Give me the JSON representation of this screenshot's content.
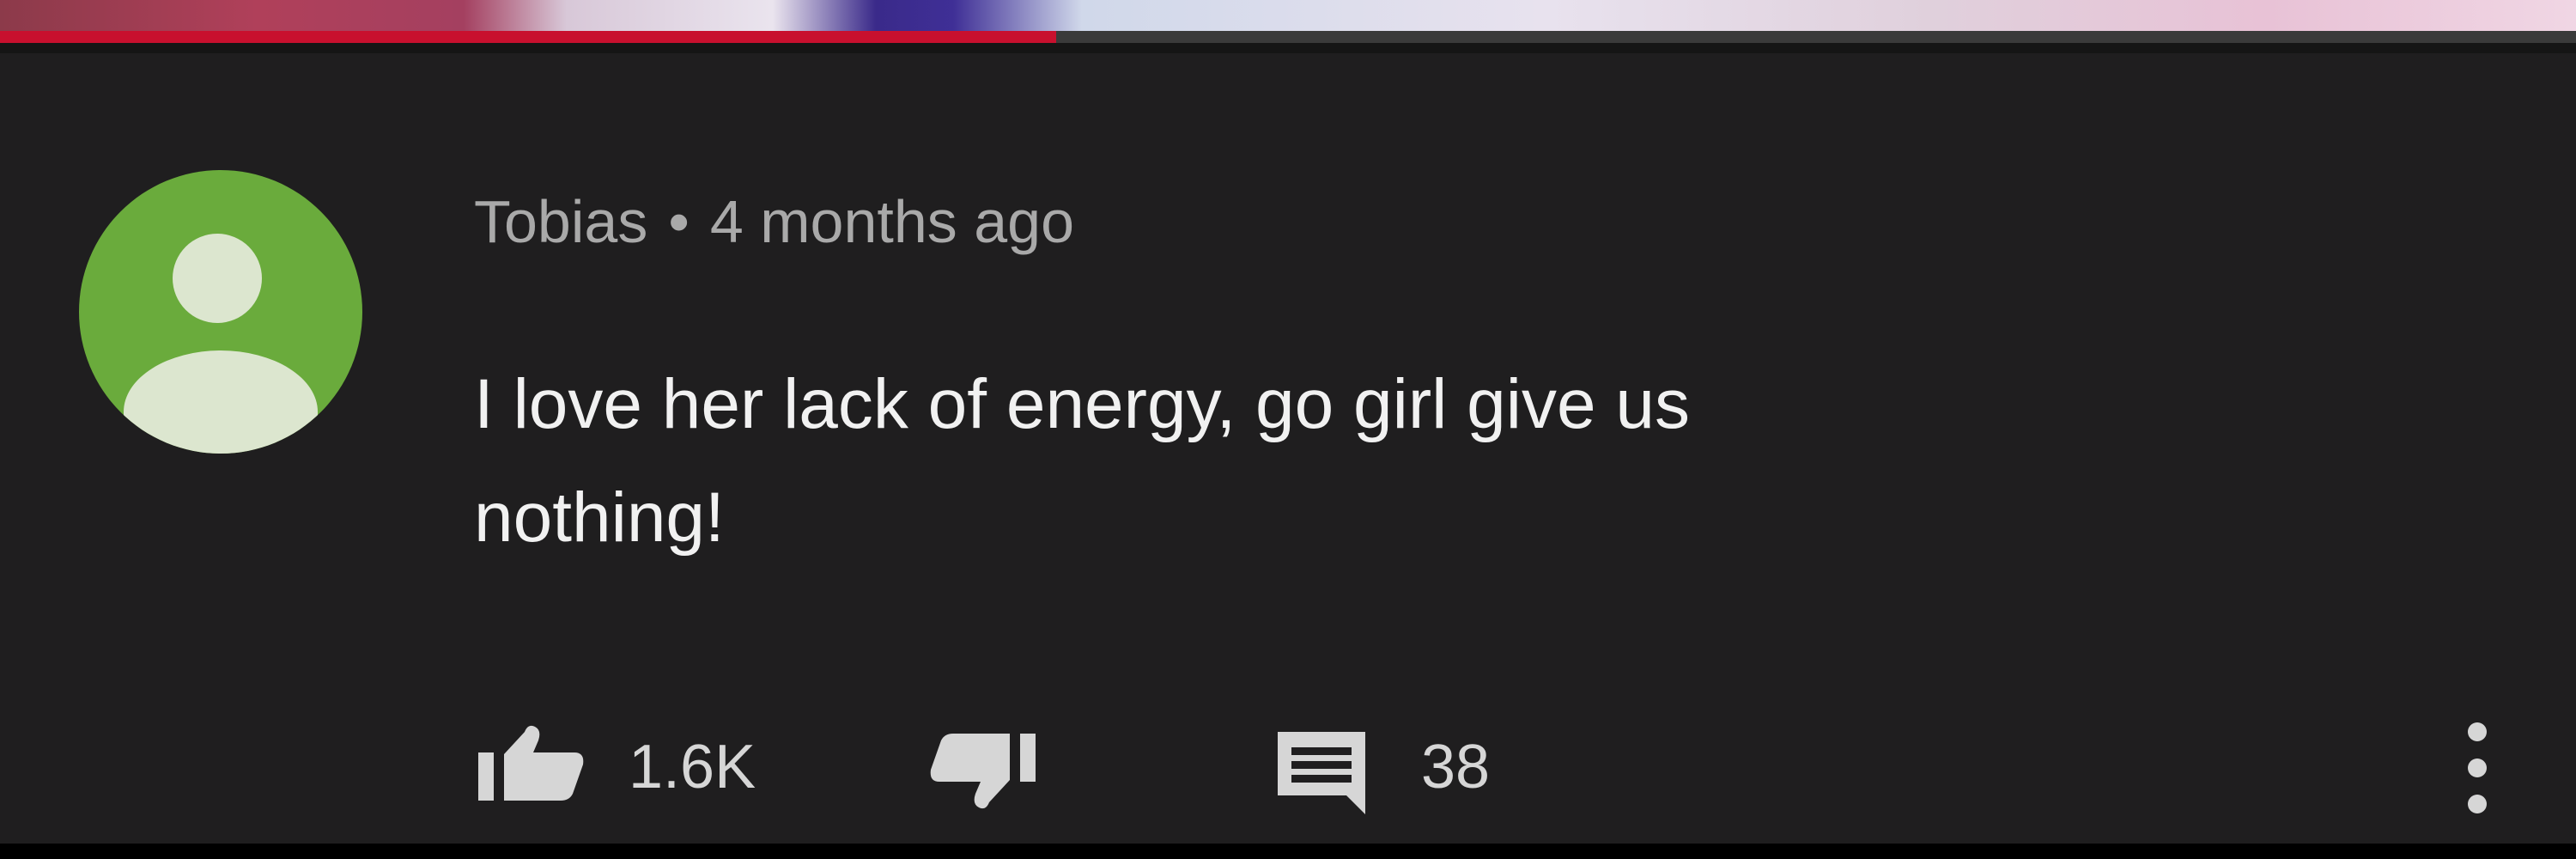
{
  "comment": {
    "author": "Tobias",
    "separator": "•",
    "timestamp": "4 months ago",
    "text_lines": [
      "I love her lack of energy, go girl give us",
      "nothing!"
    ],
    "likes": "1.6K",
    "replies": "38"
  },
  "video": {
    "progress_fraction": 0.41
  },
  "icons": {
    "avatar": "default-user-avatar-icon",
    "like": "thumbs-up-icon",
    "dislike": "thumbs-down-icon",
    "reply": "comment-reply-icon",
    "more": "vertical-ellipsis-icon"
  },
  "colors": {
    "background": "#1f1e1f",
    "avatar_bg": "#6aab3c",
    "avatar_fg": "#dce6cf",
    "progress": "#c8102e",
    "meta_text": "#a9a9a9",
    "body_text": "#f1f1f1"
  }
}
